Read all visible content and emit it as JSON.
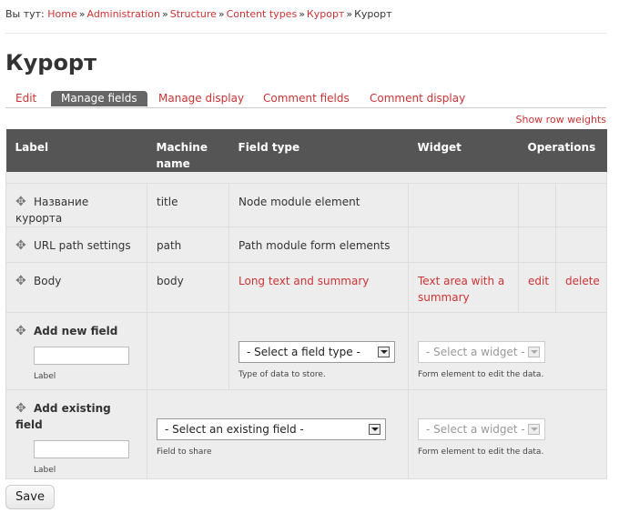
{
  "breadcrumb": {
    "prefix": "Вы тут:",
    "items": [
      "Home",
      "Administration",
      "Structure",
      "Content types",
      "Курорт"
    ],
    "current": "Курорт",
    "separator": "»"
  },
  "page_title": "Курорт",
  "tabs": [
    {
      "label": "Edit",
      "active": false
    },
    {
      "label": "Manage fields",
      "active": true
    },
    {
      "label": "Manage display",
      "active": false
    },
    {
      "label": "Comment fields",
      "active": false
    },
    {
      "label": "Comment display",
      "active": false
    }
  ],
  "show_row_weights": "Show row weights",
  "table": {
    "headers": {
      "label": "Label",
      "machine_name": "Machine name",
      "field_type": "Field type",
      "widget": "Widget",
      "operations": "Operations"
    },
    "rows": [
      {
        "label": "Название курорта",
        "machine": "title",
        "type": "Node module element",
        "widget": "",
        "edit": "",
        "delete": ""
      },
      {
        "label": "URL path settings",
        "machine": "path",
        "type": "Path module form elements",
        "widget": "",
        "edit": "",
        "delete": ""
      },
      {
        "label": "Body",
        "machine": "body",
        "type": "Long text and summary",
        "widget": "Text area with a summary",
        "edit": "edit",
        "delete": "delete"
      }
    ],
    "add_new": {
      "title": "Add new field",
      "input_label": "Label",
      "type_select": "- Select a field type -",
      "type_help": "Type of data to store.",
      "widget_select": "- Select a widget -",
      "widget_help": "Form element to edit the data."
    },
    "add_existing": {
      "title": "Add existing field",
      "input_label": "Label",
      "existing_select": "- Select an existing field -",
      "existing_help": "Field to share",
      "widget_select": "- Select a widget -",
      "widget_help": "Form element to edit the data."
    }
  },
  "save_label": "Save",
  "colors": {
    "accent": "#cc3333",
    "header_bg": "#555555",
    "row_bg": "#ededed"
  }
}
